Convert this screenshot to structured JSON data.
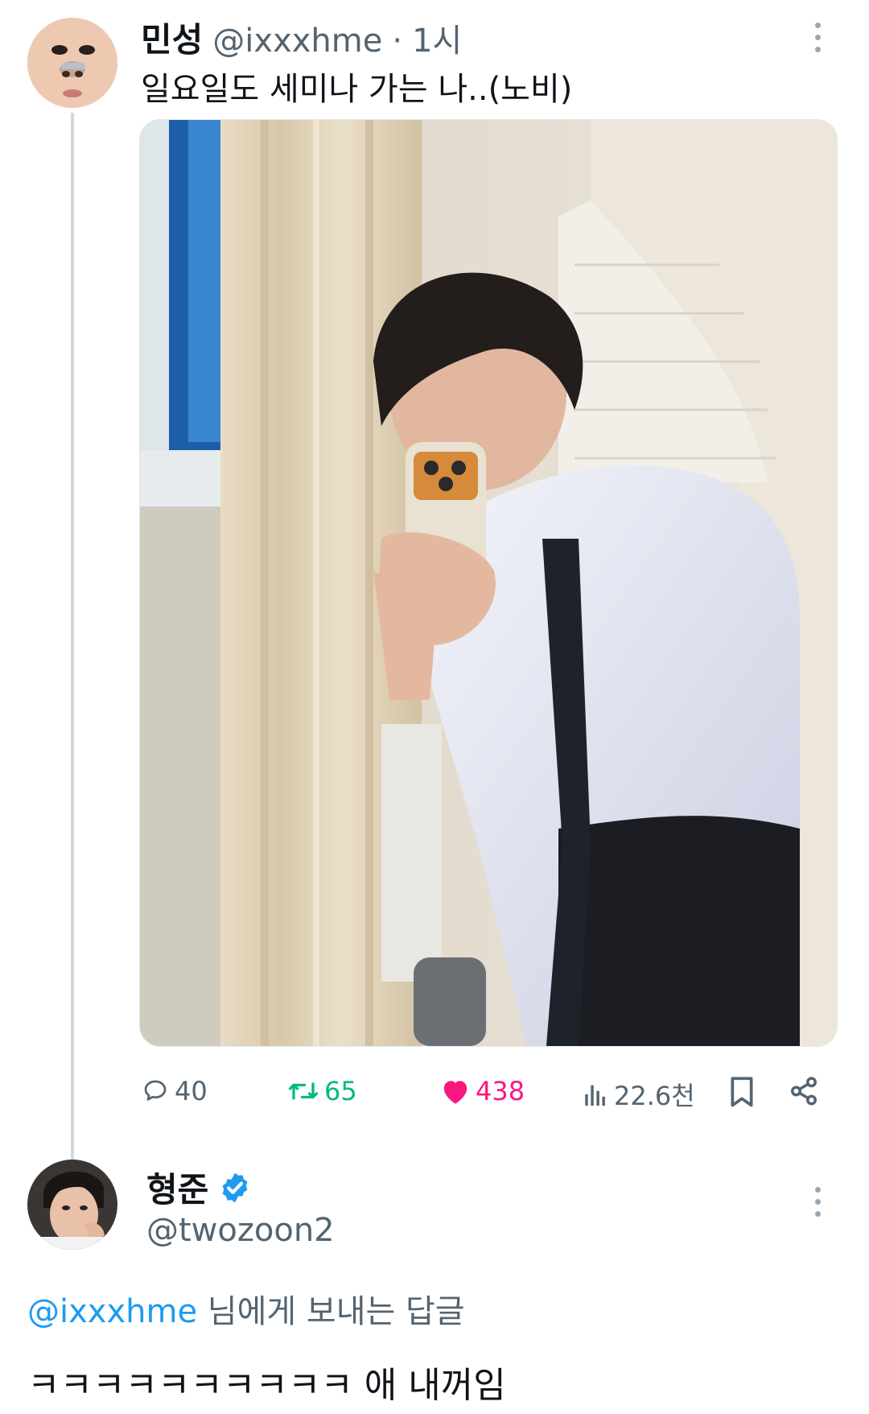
{
  "tweet": {
    "author_name": "민성",
    "handle": "@ixxxhme",
    "separator": "·",
    "time": "1시",
    "text": "일요일도 세미나 가는 나..(노비)",
    "metrics": {
      "replies": "40",
      "retweets": "65",
      "likes": "438",
      "views": "22.6천"
    }
  },
  "reply": {
    "author_name": "형준",
    "handle": "@twozoon2",
    "reply_to_mention": "@ixxxhme",
    "reply_to_suffix": " 님에게 보내는 답글",
    "text": "ㅋㅋㅋㅋㅋㅋㅋㅋㅋㅋ 애 내꺼임"
  },
  "icons": {
    "reply": "comment-icon",
    "retweet": "retweet-icon",
    "like": "heart-icon",
    "views": "views-icon",
    "bookmark": "bookmark-icon",
    "share": "share-icon",
    "verified": "verified-badge-icon",
    "more": "more-icon"
  },
  "colors": {
    "retweet_green": "#00ba7c",
    "like_pink": "#f91880",
    "link_blue": "#1d9bf0",
    "muted_gray": "#536471"
  }
}
